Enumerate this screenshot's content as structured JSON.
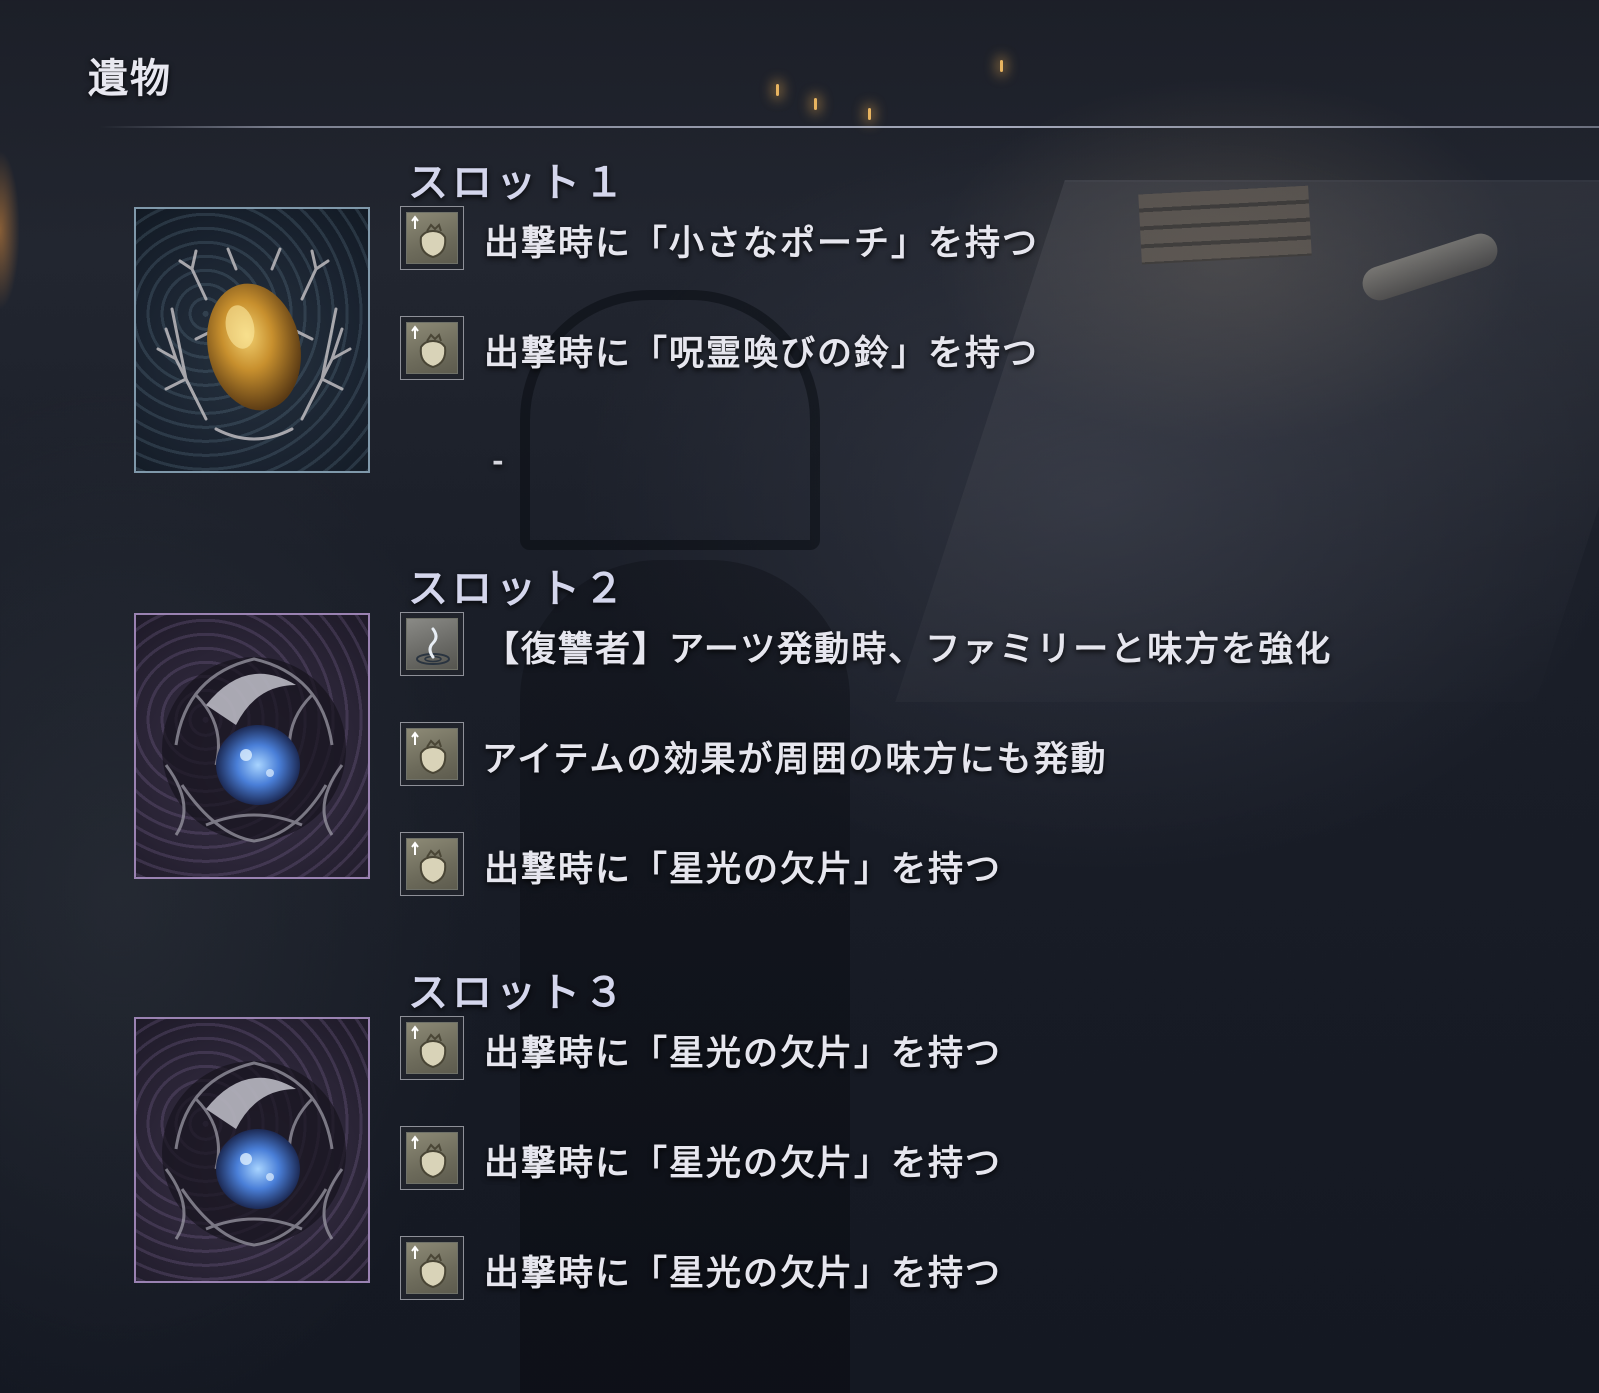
{
  "header": {
    "title": "遺物"
  },
  "slots": [
    {
      "title": "スロット１",
      "relic_icon": "amber-relic-icon",
      "relic_color": "#c89030",
      "effects": [
        {
          "icon": "pouch-icon",
          "text": "出撃時に「小さなポーチ」を持つ"
        },
        {
          "icon": "pouch-icon",
          "text": "出撃時に「呪霊喚びの鈴」を持つ"
        }
      ],
      "empty_marker": "-"
    },
    {
      "title": "スロット２",
      "relic_icon": "starlight-relic-icon",
      "relic_color": "#5f8ee0",
      "effects": [
        {
          "icon": "arts-icon",
          "text": "【復讐者】アーツ発動時、ファミリーと味方を強化"
        },
        {
          "icon": "pouch-icon",
          "text": "アイテムの効果が周囲の味方にも発動"
        },
        {
          "icon": "pouch-icon",
          "text": "出撃時に「星光の欠片」を持つ"
        }
      ]
    },
    {
      "title": "スロット３",
      "relic_icon": "starlight-relic-icon",
      "relic_color": "#5f8ee0",
      "effects": [
        {
          "icon": "pouch-icon",
          "text": "出撃時に「星光の欠片」を持つ"
        },
        {
          "icon": "pouch-icon",
          "text": "出撃時に「星光の欠片」を持つ"
        },
        {
          "icon": "pouch-icon",
          "text": "出撃時に「星光の欠片」を持つ"
        }
      ]
    }
  ]
}
